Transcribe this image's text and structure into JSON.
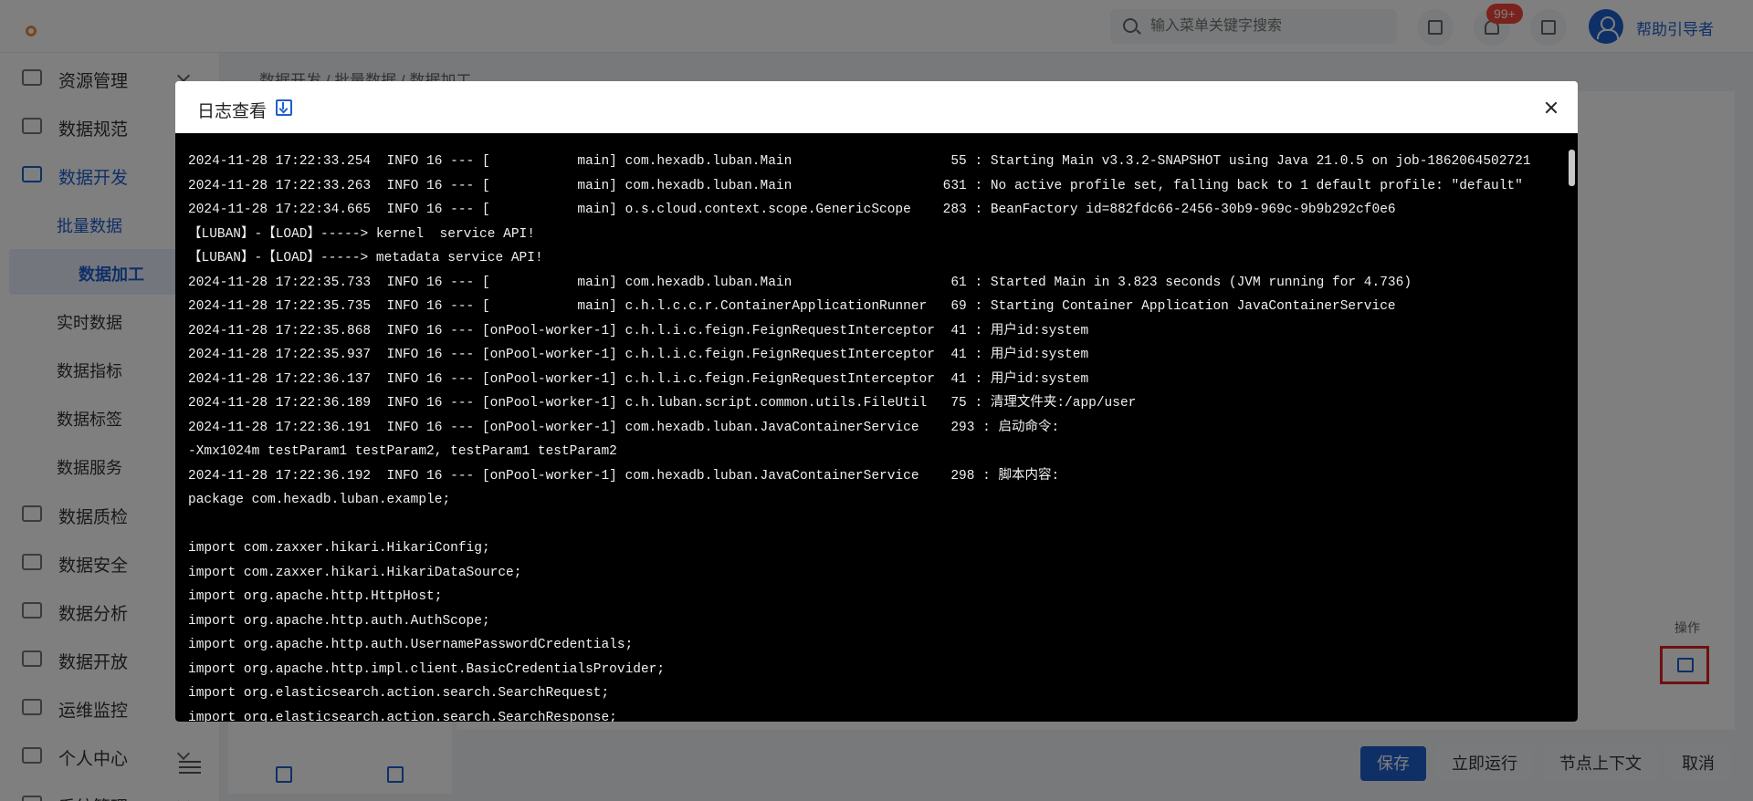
{
  "header": {
    "search_placeholder": "输入菜单关键字搜索",
    "notification_count": "99+",
    "username": "帮助引导者"
  },
  "sidebar": {
    "items": [
      {
        "label": "资源管理",
        "icon": "monitor-icon"
      },
      {
        "label": "数据规范",
        "icon": "document-icon"
      },
      {
        "label": "数据开发",
        "icon": "code-icon",
        "active": true
      },
      {
        "label": "数据质检",
        "icon": "checklist-icon"
      },
      {
        "label": "数据安全",
        "icon": "shield-icon"
      },
      {
        "label": "数据分析",
        "icon": "chart-icon"
      },
      {
        "label": "数据开放",
        "icon": "share-icon"
      },
      {
        "label": "运维监控",
        "icon": "line-chart-icon"
      },
      {
        "label": "个人中心",
        "icon": "user-icon"
      },
      {
        "label": "系统管理",
        "icon": "settings-icon"
      }
    ],
    "sub_items": [
      {
        "label": "批量数据"
      },
      {
        "label": "数据加工"
      },
      {
        "label": "实时数据"
      },
      {
        "label": "数据指标"
      },
      {
        "label": "数据标签"
      },
      {
        "label": "数据服务"
      }
    ]
  },
  "breadcrumb": {
    "items": [
      "数据开发",
      "批量数据",
      "数据加工"
    ]
  },
  "table": {
    "action_header": "操作"
  },
  "footer_buttons": {
    "save": "保存",
    "run_now": "立即运行",
    "node_context": "节点上下文",
    "cancel": "取消"
  },
  "modal": {
    "title": "日志查看",
    "log_lines": [
      "2024-11-28 17:22:33.254  INFO 16 --- [           main] com.hexadb.luban.Main                    55 : Starting Main v3.3.2-SNAPSHOT using Java 21.0.5 on job-1862064502721",
      "2024-11-28 17:22:33.263  INFO 16 --- [           main] com.hexadb.luban.Main                   631 : No active profile set, falling back to 1 default profile: \"default\"",
      "2024-11-28 17:22:34.665  INFO 16 --- [           main] o.s.cloud.context.scope.GenericScope    283 : BeanFactory id=882fdc66-2456-30b9-969c-9b9b292cf0e6",
      "【LUBAN】-【LOAD】-----> kernel  service API!",
      "【LUBAN】-【LOAD】-----> metadata service API!",
      "2024-11-28 17:22:35.733  INFO 16 --- [           main] com.hexadb.luban.Main                    61 : Started Main in 3.823 seconds (JVM running for 4.736)",
      "2024-11-28 17:22:35.735  INFO 16 --- [           main] c.h.l.c.c.r.ContainerApplicationRunner   69 : Starting Container Application JavaContainerService",
      "2024-11-28 17:22:35.868  INFO 16 --- [onPool-worker-1] c.h.l.i.c.feign.FeignRequestInterceptor  41 : 用户id:system",
      "2024-11-28 17:22:35.937  INFO 16 --- [onPool-worker-1] c.h.l.i.c.feign.FeignRequestInterceptor  41 : 用户id:system",
      "2024-11-28 17:22:36.137  INFO 16 --- [onPool-worker-1] c.h.l.i.c.feign.FeignRequestInterceptor  41 : 用户id:system",
      "2024-11-28 17:22:36.189  INFO 16 --- [onPool-worker-1] c.h.luban.script.common.utils.FileUtil   75 : 清理文件夹:/app/user",
      "2024-11-28 17:22:36.191  INFO 16 --- [onPool-worker-1] com.hexadb.luban.JavaContainerService    293 : 启动命令:",
      "-Xmx1024m testParam1 testParam2, testParam1 testParam2",
      "2024-11-28 17:22:36.192  INFO 16 --- [onPool-worker-1] com.hexadb.luban.JavaContainerService    298 : 脚本内容:",
      "package com.hexadb.luban.example;",
      "",
      "import com.zaxxer.hikari.HikariConfig;",
      "import com.zaxxer.hikari.HikariDataSource;",
      "import org.apache.http.HttpHost;",
      "import org.apache.http.auth.AuthScope;",
      "import org.apache.http.auth.UsernamePasswordCredentials;",
      "import org.apache.http.impl.client.BasicCredentialsProvider;",
      "import org.elasticsearch.action.search.SearchRequest;",
      "import org.elasticsearch.action.search.SearchResponse;"
    ]
  }
}
